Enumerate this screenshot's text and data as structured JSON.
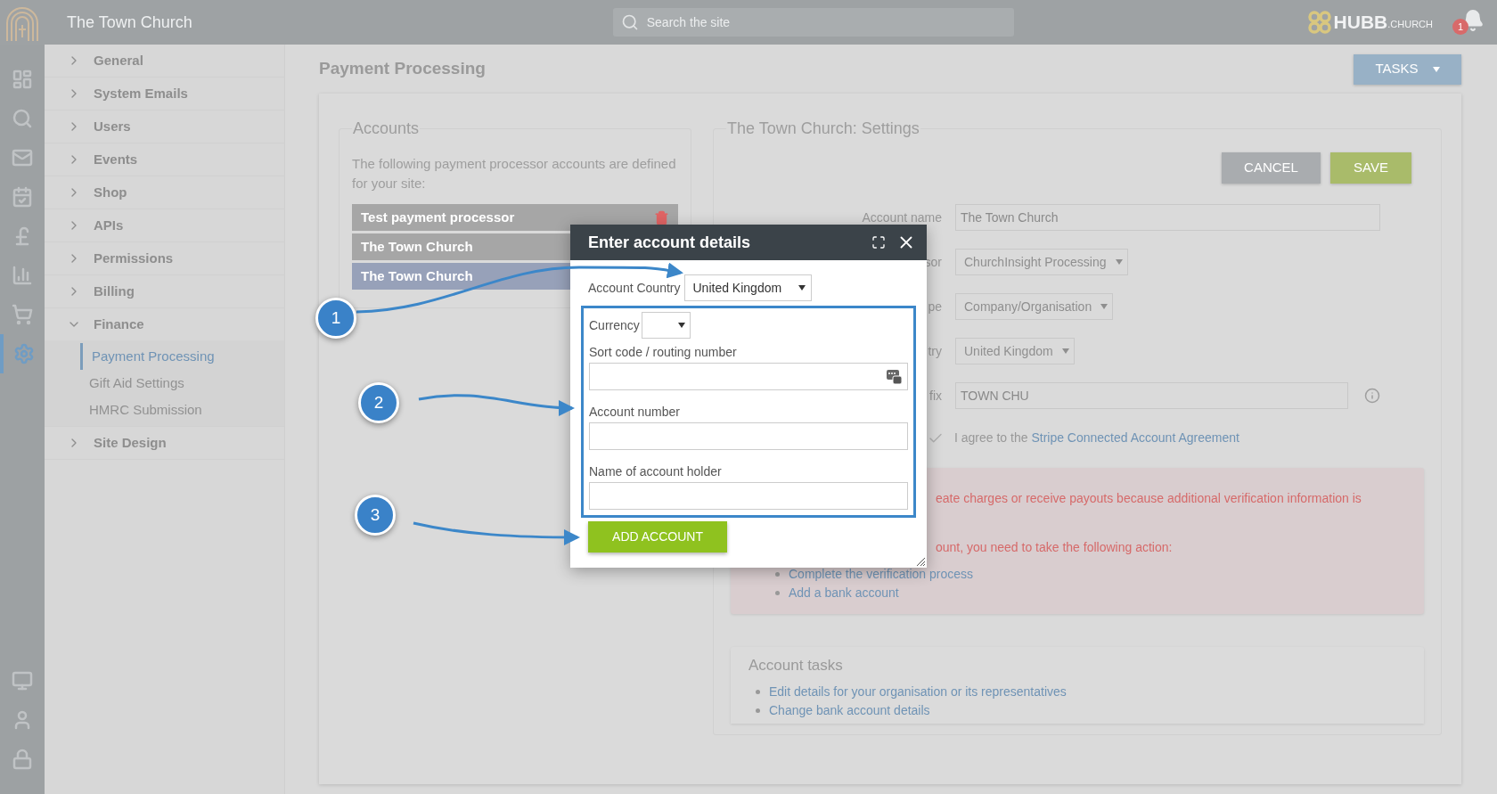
{
  "topbar": {
    "site_name": "The Town Church",
    "search": {
      "placeholder": "Search the site"
    },
    "brand": {
      "main": "HUBB",
      "suffix": ".CHURCH"
    },
    "notifications": {
      "count": "1"
    }
  },
  "rail": [
    {
      "kind": "dashboard",
      "selected": false
    },
    {
      "kind": "search",
      "selected": false
    },
    {
      "kind": "mail",
      "selected": false
    },
    {
      "kind": "calendar",
      "selected": false
    },
    {
      "kind": "pound",
      "selected": false
    },
    {
      "kind": "chart",
      "selected": false
    },
    {
      "kind": "cart",
      "selected": false
    },
    {
      "kind": "settings",
      "selected": true
    }
  ],
  "rail_bottom": [
    {
      "kind": "monitor",
      "selected": false
    },
    {
      "kind": "user",
      "selected": false
    },
    {
      "kind": "lock",
      "selected": false
    }
  ],
  "sidebar": [
    {
      "label": "General",
      "expanded": false
    },
    {
      "label": "System Emails",
      "expanded": false
    },
    {
      "label": "Users",
      "expanded": false
    },
    {
      "label": "Events",
      "expanded": false
    },
    {
      "label": "Shop",
      "expanded": false
    },
    {
      "label": "APIs",
      "expanded": false
    },
    {
      "label": "Permissions",
      "expanded": false
    },
    {
      "label": "Billing",
      "expanded": false
    },
    {
      "label": "Finance",
      "expanded": true,
      "children": [
        {
          "label": "Payment Processing",
          "selected": true
        },
        {
          "label": "Gift Aid Settings",
          "selected": false
        },
        {
          "label": "HMRC Submission",
          "selected": false
        }
      ]
    },
    {
      "label": "Site Design",
      "expanded": false
    }
  ],
  "page": {
    "title": "Payment Processing",
    "tasks_button": "TASKS"
  },
  "accounts": {
    "legend": "Accounts",
    "description": "The following payment processor accounts are defined for your site:",
    "items": [
      {
        "name": "Test payment processor",
        "selected": false,
        "deletable": true
      },
      {
        "name": "The Town Church",
        "selected": false,
        "deletable": false
      },
      {
        "name": "The Town Church",
        "selected": true,
        "deletable": false
      }
    ]
  },
  "settings": {
    "legend": "The Town Church: Settings",
    "buttons": [
      {
        "label": "CANCEL",
        "kind": "cancel"
      },
      {
        "label": "SAVE",
        "kind": "save"
      }
    ],
    "fields": [
      {
        "label": "Account name",
        "kind": "text",
        "value": "The Town Church",
        "info": false
      },
      {
        "label": "sor",
        "kind": "select",
        "value": "ChurchInsight Processing",
        "info": false
      },
      {
        "label": "pe",
        "kind": "select",
        "value": "Company/Organisation",
        "info": false
      },
      {
        "label": "try",
        "kind": "select",
        "value": "United Kingdom",
        "info": false
      },
      {
        "label": "fix",
        "kind": "text",
        "value": "TOWN CHU",
        "info": true
      }
    ],
    "agreement": {
      "checked": true,
      "text": "I agree to the",
      "link": "Stripe Connected Account Agreement"
    },
    "alert": {
      "lines": [
        "eate charges or receive payouts because additional verification information is",
        "ount, you need to take the following action:"
      ],
      "actions": [
        "Complete the verification process",
        "Add a bank account"
      ]
    },
    "tasks": {
      "title": "Account tasks",
      "links": [
        "Edit details for your organisation or its representatives",
        "Change bank account details"
      ]
    }
  },
  "dialog": {
    "title": "Enter account details",
    "country": {
      "label": "Account Country",
      "value": "United Kingdom"
    },
    "currency": {
      "label": "Currency"
    },
    "fields": [
      {
        "label": "Sort code / routing number",
        "keypad": true
      },
      {
        "label": "Account number",
        "keypad": false
      },
      {
        "label": "Name of account holder",
        "keypad": false
      }
    ],
    "submit": "ADD ACCOUNT"
  },
  "callouts": [
    "1",
    "2",
    "3"
  ]
}
